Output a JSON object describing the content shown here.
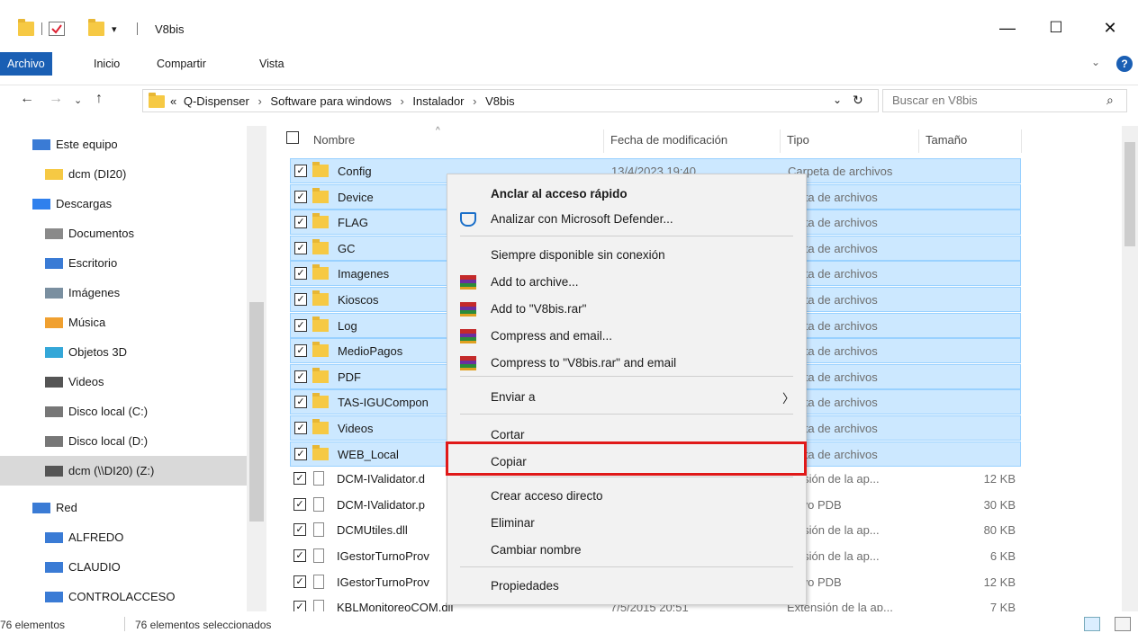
{
  "window": {
    "title": "V8bis",
    "minimize": "—",
    "maximize": "☐",
    "close": "✕"
  },
  "ribbon": {
    "tabs": [
      "Archivo",
      "Inicio",
      "Compartir",
      "Vista"
    ],
    "help": "?"
  },
  "address": {
    "prefix": "«",
    "crumbs": [
      "Q-Dispenser",
      "Software para windows",
      "Instalador",
      "V8bis"
    ],
    "search_placeholder": "Buscar en V8bis"
  },
  "sidebar": {
    "items": [
      {
        "label": "Este equipo",
        "icon": "computer-icon"
      },
      {
        "label": "dcm (DI20)",
        "icon": "user-folder-icon"
      },
      {
        "label": "Descargas",
        "icon": "downloads-icon"
      },
      {
        "label": "Documentos",
        "icon": "documents-icon"
      },
      {
        "label": "Escritorio",
        "icon": "desktop-icon"
      },
      {
        "label": "Imágenes",
        "icon": "pictures-icon"
      },
      {
        "label": "Música",
        "icon": "music-icon"
      },
      {
        "label": "Objetos 3D",
        "icon": "3d-objects-icon"
      },
      {
        "label": "Videos",
        "icon": "videos-icon"
      },
      {
        "label": "Disco local (C:)",
        "icon": "drive-icon"
      },
      {
        "label": "Disco local (D:)",
        "icon": "drive-icon"
      },
      {
        "label": "dcm (\\\\DI20) (Z:)",
        "icon": "network-drive-icon"
      },
      {
        "label": "Red",
        "icon": "network-icon"
      },
      {
        "label": "ALFREDO",
        "icon": "computer-icon"
      },
      {
        "label": "CLAUDIO",
        "icon": "computer-icon"
      },
      {
        "label": "CONTROLACCESO",
        "icon": "computer-icon"
      }
    ]
  },
  "columns": {
    "name": "Nombre",
    "date": "Fecha de modificación",
    "type": "Tipo",
    "size": "Tamaño"
  },
  "files": [
    {
      "name": "Config",
      "date": "13/4/2023 19:40",
      "type": "Carpeta de archivos",
      "size": "",
      "kind": "folder"
    },
    {
      "name": "Device",
      "date": "",
      "type": "rpeta de archivos",
      "size": "",
      "kind": "folder"
    },
    {
      "name": "FLAG",
      "date": "",
      "type": "rpeta de archivos",
      "size": "",
      "kind": "folder"
    },
    {
      "name": "GC",
      "date": "",
      "type": "rpeta de archivos",
      "size": "",
      "kind": "folder"
    },
    {
      "name": "Imagenes",
      "date": "",
      "type": "rpeta de archivos",
      "size": "",
      "kind": "folder"
    },
    {
      "name": "Kioscos",
      "date": "",
      "type": "rpeta de archivos",
      "size": "",
      "kind": "folder"
    },
    {
      "name": "Log",
      "date": "",
      "type": "rpeta de archivos",
      "size": "",
      "kind": "folder"
    },
    {
      "name": "MedioPagos",
      "date": "",
      "type": "rpeta de archivos",
      "size": "",
      "kind": "folder"
    },
    {
      "name": "PDF",
      "date": "",
      "type": "rpeta de archivos",
      "size": "",
      "kind": "folder"
    },
    {
      "name": "TAS-IGUCompon",
      "date": "",
      "type": "rpeta de archivos",
      "size": "",
      "kind": "folder"
    },
    {
      "name": "Videos",
      "date": "",
      "type": "rpeta de archivos",
      "size": "",
      "kind": "folder"
    },
    {
      "name": "WEB_Local",
      "date": "",
      "type": "rpeta de archivos",
      "size": "",
      "kind": "folder"
    },
    {
      "name": "DCM-IValidator.d",
      "date": "",
      "type": "tensión de la ap...",
      "size": "12 KB",
      "kind": "file"
    },
    {
      "name": "DCM-IValidator.p",
      "date": "",
      "type": "chivo PDB",
      "size": "30 KB",
      "kind": "file"
    },
    {
      "name": "DCMUtiles.dll",
      "date": "",
      "type": "tensión de la ap...",
      "size": "80 KB",
      "kind": "file"
    },
    {
      "name": "IGestorTurnoProv",
      "date": "",
      "type": "tensión de la ap...",
      "size": "6 KB",
      "kind": "file"
    },
    {
      "name": "IGestorTurnoProv",
      "date": "",
      "type": "chivo PDB",
      "size": "12 KB",
      "kind": "file"
    },
    {
      "name": "KBLMonitoreoCOM.dll",
      "date": "7/5/2015 20:51",
      "type": "Extensión de la ap...",
      "size": "7 KB",
      "kind": "file"
    }
  ],
  "context_menu": {
    "items": [
      {
        "label": "Anclar al acceso rápido",
        "bold": true,
        "icon": ""
      },
      {
        "label": "Analizar con Microsoft Defender...",
        "bold": false,
        "icon": "defender-icon"
      },
      {
        "label": "Siempre disponible sin conexión",
        "bold": false,
        "icon": ""
      },
      {
        "label": "Add to archive...",
        "bold": false,
        "icon": "winrar-icon"
      },
      {
        "label": "Add to \"V8bis.rar\"",
        "bold": false,
        "icon": "winrar-icon"
      },
      {
        "label": "Compress and email...",
        "bold": false,
        "icon": "winrar-icon"
      },
      {
        "label": "Compress to \"V8bis.rar\" and email",
        "bold": false,
        "icon": "winrar-icon"
      },
      {
        "label": "Enviar a",
        "bold": false,
        "icon": ""
      },
      {
        "label": "Cortar",
        "bold": false,
        "icon": ""
      },
      {
        "label": "Copiar",
        "bold": false,
        "icon": ""
      },
      {
        "label": "Crear acceso directo",
        "bold": false,
        "icon": ""
      },
      {
        "label": "Eliminar",
        "bold": false,
        "icon": ""
      },
      {
        "label": "Cambiar nombre",
        "bold": false,
        "icon": ""
      },
      {
        "label": "Propiedades",
        "bold": false,
        "icon": ""
      }
    ],
    "submenu_arrow": "〉"
  },
  "status": {
    "count": "76 elementos",
    "selected": "76 elementos seleccionados"
  },
  "colors": {
    "accent": "#1a5fb4",
    "selection": "#cce8ff",
    "highlight_box": "#e01919"
  }
}
